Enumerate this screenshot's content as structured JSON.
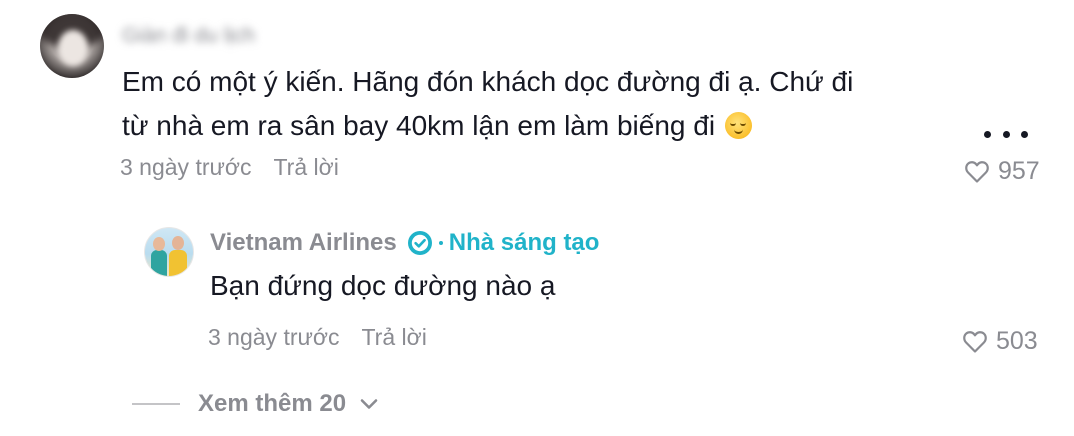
{
  "comment": {
    "username": "Giàn đi du lịch",
    "text_line1": "Em có một ý kiến. Hãng đón khách dọc đường đi ạ. Chứ đi",
    "text_line2": "từ nhà em ra sân bay 40km lận em làm biếng đi",
    "emoji_icon": "relieved-face-emoji",
    "time": "3 ngày trước",
    "reply_label": "Trả lời",
    "likes": "957"
  },
  "reply": {
    "author": "Vietnam Airlines",
    "badge": "Nhà sáng tạo",
    "text": "Bạn đứng dọc đường nào ạ",
    "time": "3 ngày trước",
    "reply_label": "Trả lời",
    "likes": "503"
  },
  "view_more": {
    "label": "Xem thêm 20"
  },
  "colors": {
    "primary_text": "#161823",
    "secondary_text": "#8a8b91",
    "creator_accent": "#20b3c9"
  }
}
